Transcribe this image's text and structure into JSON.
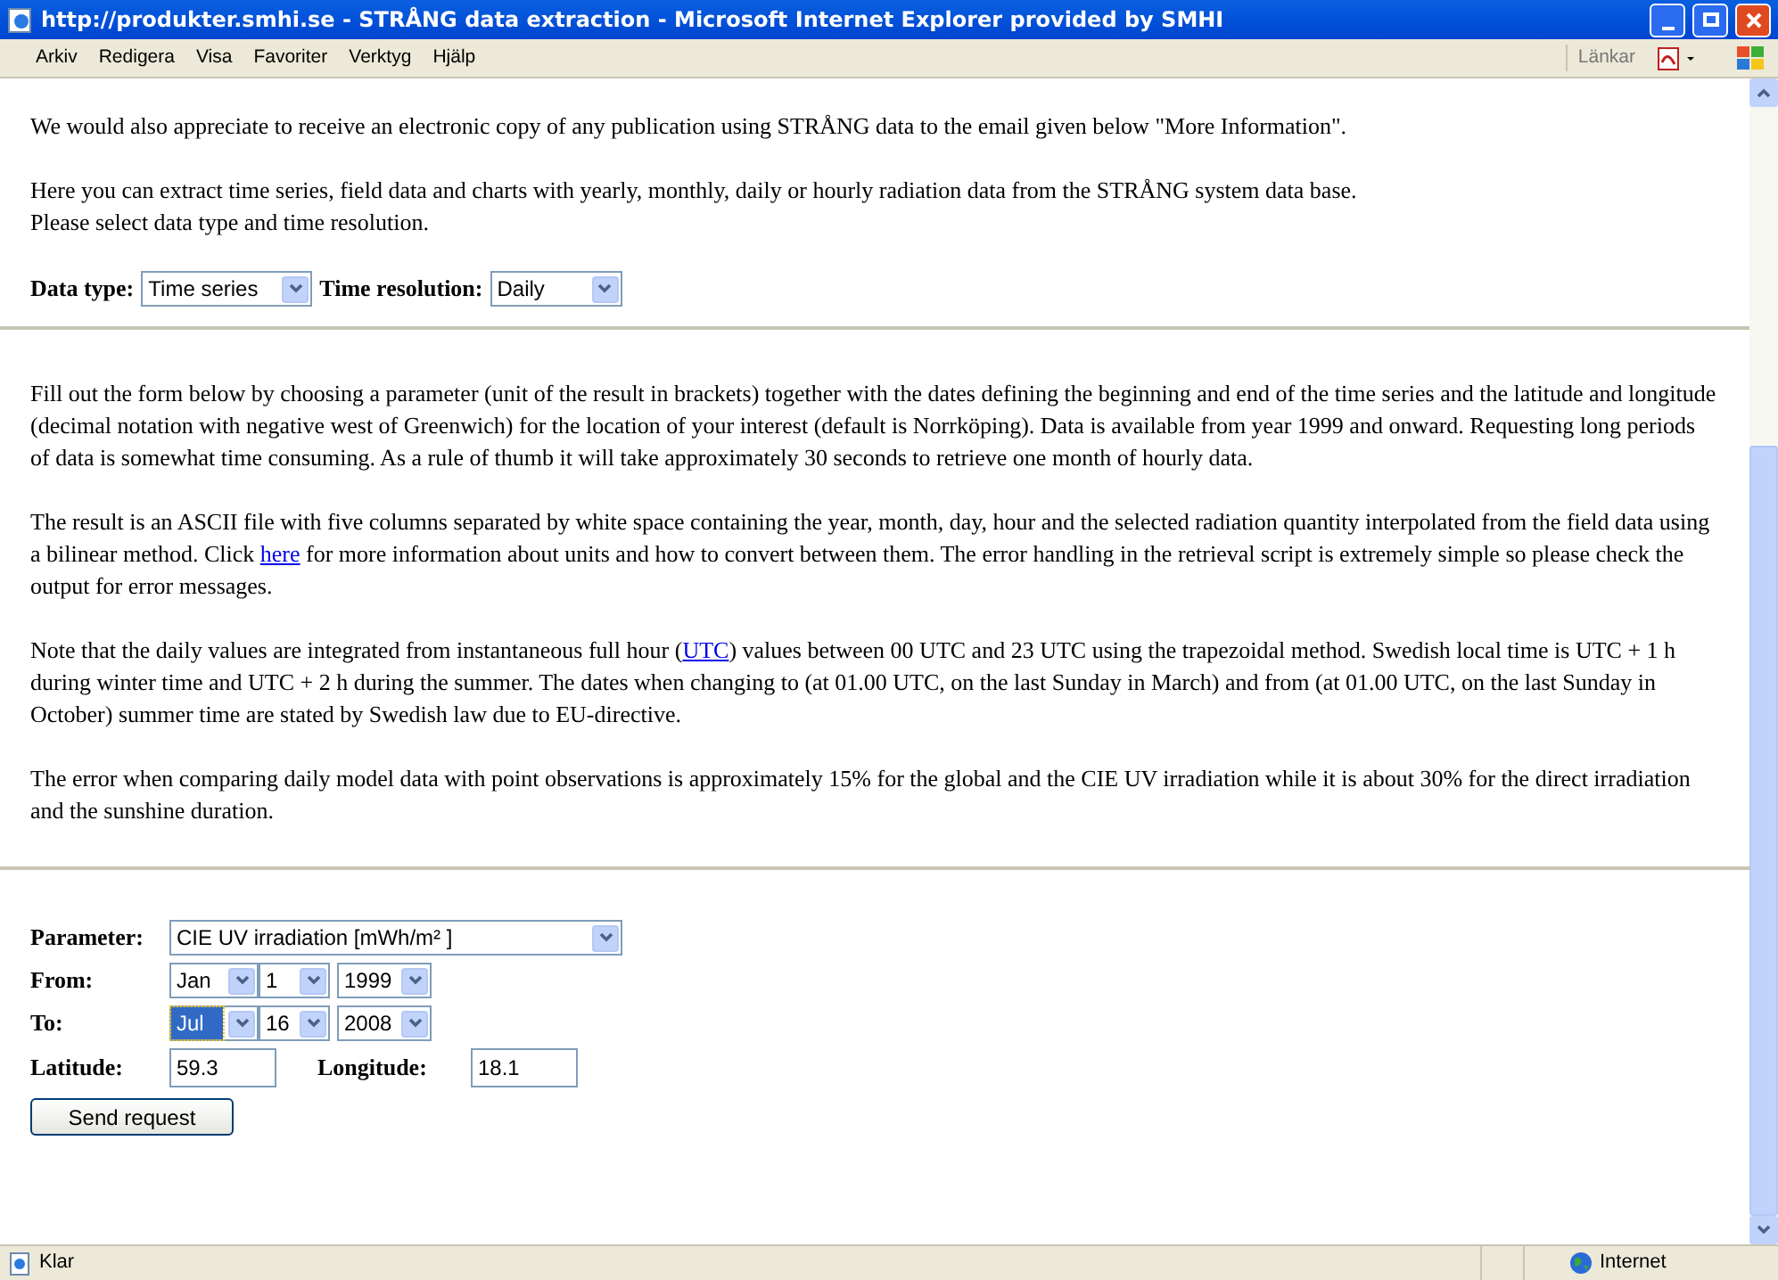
{
  "window": {
    "title": "http://produkter.smhi.se - STRÅNG data extraction - Microsoft Internet Explorer provided by SMHI"
  },
  "menu": [
    "Arkiv",
    "Redigera",
    "Visa",
    "Favoriter",
    "Verktyg",
    "Hjälp"
  ],
  "links_label": "Länkar",
  "intro": [
    [
      {
        "kind": "text",
        "text": "We would also appreciate to receive an electronic copy of any publication using STRÅNG data to the email given below \"More Information\"."
      }
    ],
    [
      {
        "kind": "text",
        "text": "Here you can extract time series, field data and charts with yearly, monthly, daily or hourly radiation data from the STRÅNG system data base."
      }
    ],
    [
      {
        "kind": "text",
        "text": "Please select data type and time resolution."
      }
    ]
  ],
  "data_type": {
    "label": "Data type:",
    "value": "Time series"
  },
  "time_resolution": {
    "label": "Time resolution:",
    "value": "Daily"
  },
  "paragraphs": [
    [
      {
        "kind": "text",
        "text": "Fill out the form below by choosing a parameter (unit of the result in brackets) together with the dates defining the beginning and end of the time series and the latitude and longitude (decimal notation with negative west of Greenwich) for the location of your interest (default is Norrköping). Data is available from year 1999 and onward. Requesting long periods of data is somewhat time consuming. As a rule of thumb it will take approximately 30 seconds to retrieve one month of hourly data."
      }
    ],
    [
      {
        "kind": "text",
        "text": "The result is an ASCII file with five columns separated by white space containing the year, month, day, hour and the selected radiation quantity interpolated from the field data using a bilinear method. Click "
      },
      {
        "kind": "link",
        "text": "here"
      },
      {
        "kind": "text",
        "text": " for more information about units and how to convert between them. The error handling in the retrieval script is extremely simple so please check the output for error messages."
      }
    ],
    [
      {
        "kind": "text",
        "text": "Note that the daily values are integrated from instantaneous full hour ("
      },
      {
        "kind": "link",
        "text": "UTC"
      },
      {
        "kind": "text",
        "text": ") values between 00 UTC and 23 UTC using the trapezoidal method. Swedish local time is UTC + 1 h during winter time and UTC + 2 h during the summer. The dates when changing to (at 01.00 UTC, on the last Sunday in March) and from (at 01.00 UTC, on the last Sunday in October) summer time are stated by Swedish law due to EU-directive."
      }
    ],
    [
      {
        "kind": "text",
        "text": "The error when comparing daily model data with point observations is approximately 15% for the global and the CIE UV irradiation while it is about 30% for the direct irradiation and the sunshine duration."
      }
    ]
  ],
  "form": {
    "parameter": {
      "label": "Parameter:",
      "value": "CIE UV irradiation [mWh/m² ]"
    },
    "from": {
      "label": "From:",
      "selects": [
        {
          "value": "Jan",
          "focused": false
        },
        {
          "value": "1",
          "focused": false
        },
        {
          "value": "1999",
          "focused": false
        }
      ]
    },
    "to": {
      "label": "To:",
      "selects": [
        {
          "value": "Jul",
          "focused": true
        },
        {
          "value": "16",
          "focused": false
        },
        {
          "value": "2008",
          "focused": false
        }
      ]
    },
    "latitude": {
      "label": "Latitude:",
      "value": "59.3"
    },
    "longitude": {
      "label": "Longitude:",
      "value": "18.1"
    },
    "submit": "Send request"
  },
  "status_bar": {
    "text": "Klar",
    "zone": "Internet"
  }
}
